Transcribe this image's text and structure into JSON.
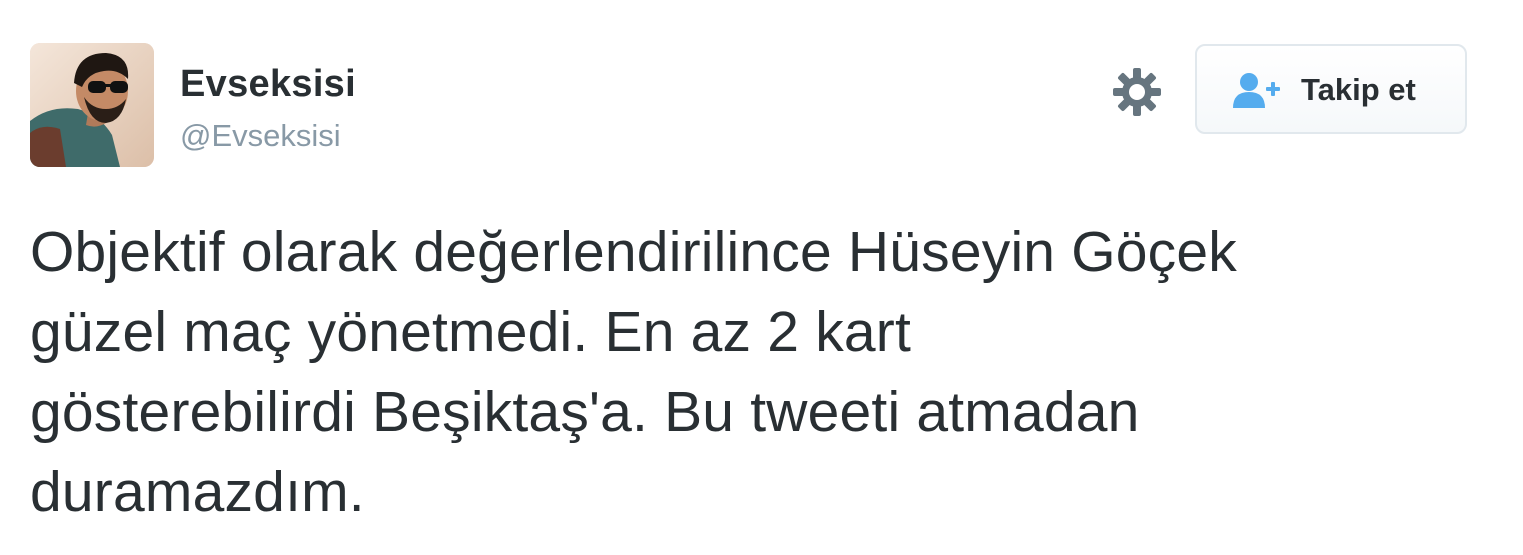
{
  "user": {
    "display_name": "Evseksisi",
    "screen_name": "@Evseksisi"
  },
  "actions": {
    "settings_icon": "gear-icon",
    "follow_label": "Takip et",
    "follow_icon": "add-user-icon",
    "accent_color": "#55acee"
  },
  "tweet": {
    "lines": [
      "Objektif olarak değerlendirilince Hüseyin Göçek",
      "güzel maç yönetmedi. En az 2 kart",
      "gösterebilirdi Beşiktaş'a. Bu tweeti atmadan",
      "duramazdım."
    ]
  }
}
